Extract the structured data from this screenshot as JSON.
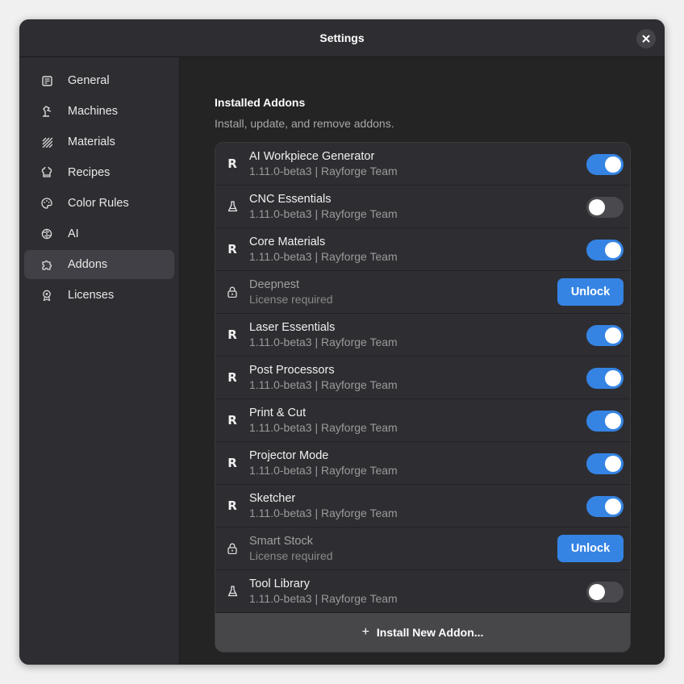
{
  "window": {
    "title": "Settings"
  },
  "sidebar": {
    "items": [
      {
        "label": "General",
        "icon": "general-icon",
        "active": false
      },
      {
        "label": "Machines",
        "icon": "machine-icon",
        "active": false
      },
      {
        "label": "Materials",
        "icon": "materials-icon",
        "active": false
      },
      {
        "label": "Recipes",
        "icon": "recipes-icon",
        "active": false
      },
      {
        "label": "Color Rules",
        "icon": "palette-icon",
        "active": false
      },
      {
        "label": "AI",
        "icon": "ai-icon",
        "active": false
      },
      {
        "label": "Addons",
        "icon": "puzzle-icon",
        "active": true
      },
      {
        "label": "Licenses",
        "icon": "license-icon",
        "active": false
      }
    ]
  },
  "main": {
    "title": "Installed Addons",
    "subtitle": "Install, update, and remove addons.",
    "addons": [
      {
        "name": "AI Workpiece Generator",
        "sub": "1.11.0-beta3 | Rayforge Team",
        "icon": "r-logo-icon",
        "enabled": true,
        "locked": false
      },
      {
        "name": "CNC Essentials",
        "sub": "1.11.0-beta3 | Rayforge Team",
        "icon": "flask-icon",
        "enabled": false,
        "locked": false
      },
      {
        "name": "Core Materials",
        "sub": "1.11.0-beta3 | Rayforge Team",
        "icon": "r-logo-icon",
        "enabled": true,
        "locked": false
      },
      {
        "name": "Deepnest",
        "sub": "License required",
        "icon": "lock-icon",
        "enabled": false,
        "locked": true
      },
      {
        "name": "Laser Essentials",
        "sub": "1.11.0-beta3 | Rayforge Team",
        "icon": "r-logo-icon",
        "enabled": true,
        "locked": false
      },
      {
        "name": "Post Processors",
        "sub": "1.11.0-beta3 | Rayforge Team",
        "icon": "r-logo-icon",
        "enabled": true,
        "locked": false
      },
      {
        "name": "Print & Cut",
        "sub": "1.11.0-beta3 | Rayforge Team",
        "icon": "r-logo-icon",
        "enabled": true,
        "locked": false
      },
      {
        "name": "Projector Mode",
        "sub": "1.11.0-beta3 | Rayforge Team",
        "icon": "r-logo-icon",
        "enabled": true,
        "locked": false
      },
      {
        "name": "Sketcher",
        "sub": "1.11.0-beta3 | Rayforge Team",
        "icon": "r-logo-icon",
        "enabled": true,
        "locked": false
      },
      {
        "name": "Smart Stock",
        "sub": "License required",
        "icon": "lock-icon",
        "enabled": false,
        "locked": true
      },
      {
        "name": "Tool Library",
        "sub": "1.11.0-beta3 | Rayforge Team",
        "icon": "flask-icon",
        "enabled": false,
        "locked": false
      }
    ],
    "unlock_label": "Unlock",
    "r_glyph": "R",
    "install": {
      "plus": "+",
      "label": "Install New Addon..."
    }
  },
  "colors": {
    "accent": "#3584e4",
    "window_bg": "#242424",
    "sidebar_bg": "#2e2e32",
    "row_bg": "#2e2e32"
  }
}
